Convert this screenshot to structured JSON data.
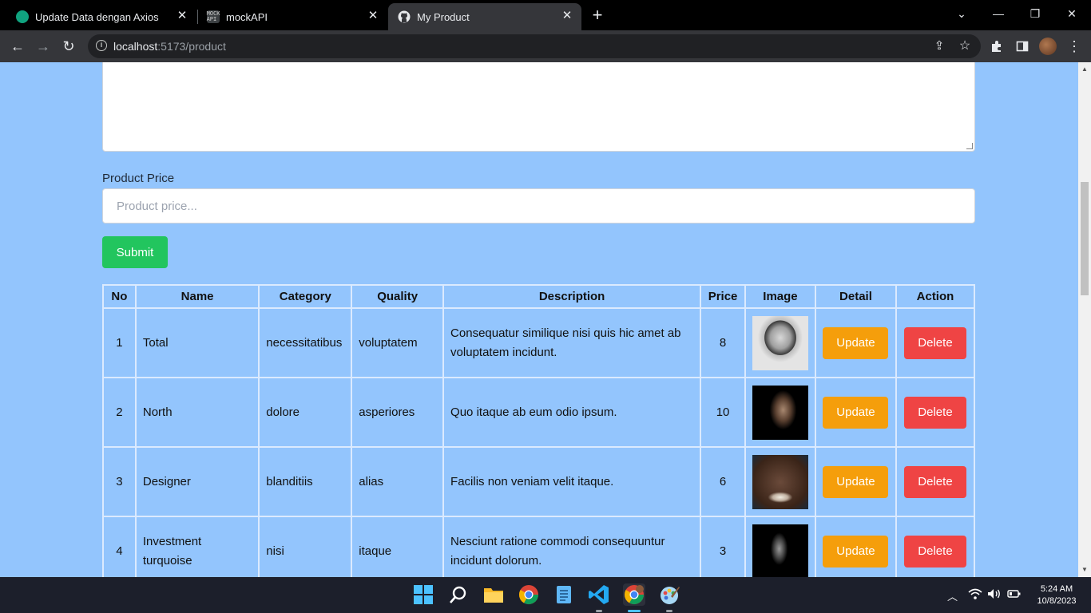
{
  "browser": {
    "tabs": [
      {
        "title": "Update Data dengan Axios",
        "icon": "chatgpt-icon"
      },
      {
        "title": "mockAPI",
        "icon": "mockapi-icon",
        "icon_text": "MOCK API"
      },
      {
        "title": "My Product",
        "icon": "github-icon"
      }
    ],
    "url_host": "localhost",
    "url_path": ":5173/product"
  },
  "form": {
    "price_label": "Product Price",
    "price_placeholder": "Product price...",
    "price_value": "",
    "submit_label": "Submit"
  },
  "table": {
    "headers": [
      "No",
      "Name",
      "Category",
      "Quality",
      "Description",
      "Price",
      "Image",
      "Detail",
      "Action"
    ],
    "rows": [
      {
        "no": "1",
        "name": "Total",
        "category": "necessitatibus",
        "quality": "voluptatem",
        "description": "Consequatur similique nisi quis hic amet ab voluptatem incidunt.",
        "price": "8",
        "detail": "Update",
        "action": "Delete"
      },
      {
        "no": "2",
        "name": "North",
        "category": "dolore",
        "quality": "asperiores",
        "description": "Quo itaque ab eum odio ipsum.",
        "price": "10",
        "detail": "Update",
        "action": "Delete"
      },
      {
        "no": "3",
        "name": "Designer",
        "category": "blanditiis",
        "quality": "alias",
        "description": "Facilis non veniam velit itaque.",
        "price": "6",
        "detail": "Update",
        "action": "Delete"
      },
      {
        "no": "4",
        "name": "Investment turquoise",
        "category": "nisi",
        "quality": "itaque",
        "description": "Nesciunt ratione commodi consequuntur incidunt dolorum.",
        "price": "3",
        "detail": "Update",
        "action": "Delete"
      }
    ]
  },
  "colors": {
    "page_bg": "#93c5fd",
    "submit": "#22c55e",
    "update": "#f59e0b",
    "delete": "#ef4444"
  },
  "taskbar": {
    "time": "5:24 AM",
    "date": "10/8/2023"
  }
}
